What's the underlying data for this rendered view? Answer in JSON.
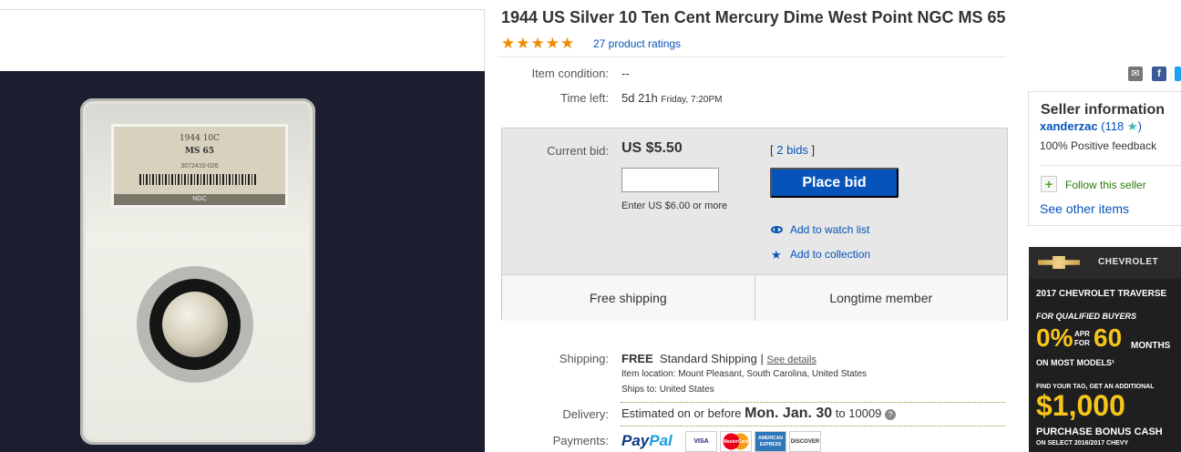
{
  "listing": {
    "title": "1944 US Silver 10 Ten Cent Mercury Dime West Point NGC MS 65",
    "stars": 5,
    "ratings_text": "27 product ratings"
  },
  "photo": {
    "slab_line1": "1944  10C",
    "slab_grade": "MS 65",
    "slab_cert": "3072410-026",
    "slab_brand": "NGC"
  },
  "details": {
    "condition_label": "Item condition:",
    "condition_value": "--",
    "time_label": "Time left:",
    "time_value": "5d 21h",
    "time_end": "Friday, 7:20PM"
  },
  "bid": {
    "current_label": "Current bid:",
    "current_value": "US $5.50",
    "bids_link": "2 bids",
    "bids_open": "[ ",
    "bids_close": " ]",
    "input_value": "",
    "hint": "Enter US $6.00 or more",
    "place_bid": "Place bid",
    "watch": "Add to watch list",
    "collection": "Add to collection",
    "free_shipping": "Free shipping",
    "longtime": "Longtime member"
  },
  "shipping": {
    "label": "Shipping:",
    "free": "FREE",
    "method": "Standard Shipping |",
    "see_details": "See details",
    "location_label": "Item location:",
    "location": "Mount Pleasant, South Carolina, United States",
    "ships_label": "Ships to:",
    "ships_to": "United States"
  },
  "delivery": {
    "label": "Delivery:",
    "pre": "Estimated on or before",
    "date": "Mon. Jan. 30",
    "post": "to 10009"
  },
  "payments": {
    "label": "Payments:",
    "paypal_1": "Pay",
    "paypal_2": "Pal",
    "cards": [
      "VISA",
      "MasterCard",
      "AMERICAN EXPRESS",
      "DISCOVER"
    ]
  },
  "seller": {
    "title": "Seller information",
    "name": "xanderzac",
    "score_open": "(118",
    "score_close": ")",
    "feedback": "100% Positive feedback",
    "follow": "Follow this seller",
    "other": "See other items"
  },
  "ad": {
    "brand": "CHEVROLET",
    "model": "2017 CHEVROLET TRAVERSE",
    "qualified": "FOR QUALIFIED BUYERS",
    "apr_pct": "0%",
    "apr_small_1": "APR",
    "apr_small_2": "FOR",
    "months_num": "60",
    "months": "MONTHS",
    "most_models": "ON MOST MODELS¹",
    "tag": "FIND YOUR TAG, GET AN ADDITIONAL",
    "amount": "$1,000",
    "bonus": "PURCHASE BONUS CASH",
    "select": "ON SELECT 2016/2017 CHEVY"
  },
  "colors": {
    "link": "#0654ba",
    "stars": "#f18c00",
    "button": "#0654ba",
    "follow": "#2b7a0b"
  }
}
